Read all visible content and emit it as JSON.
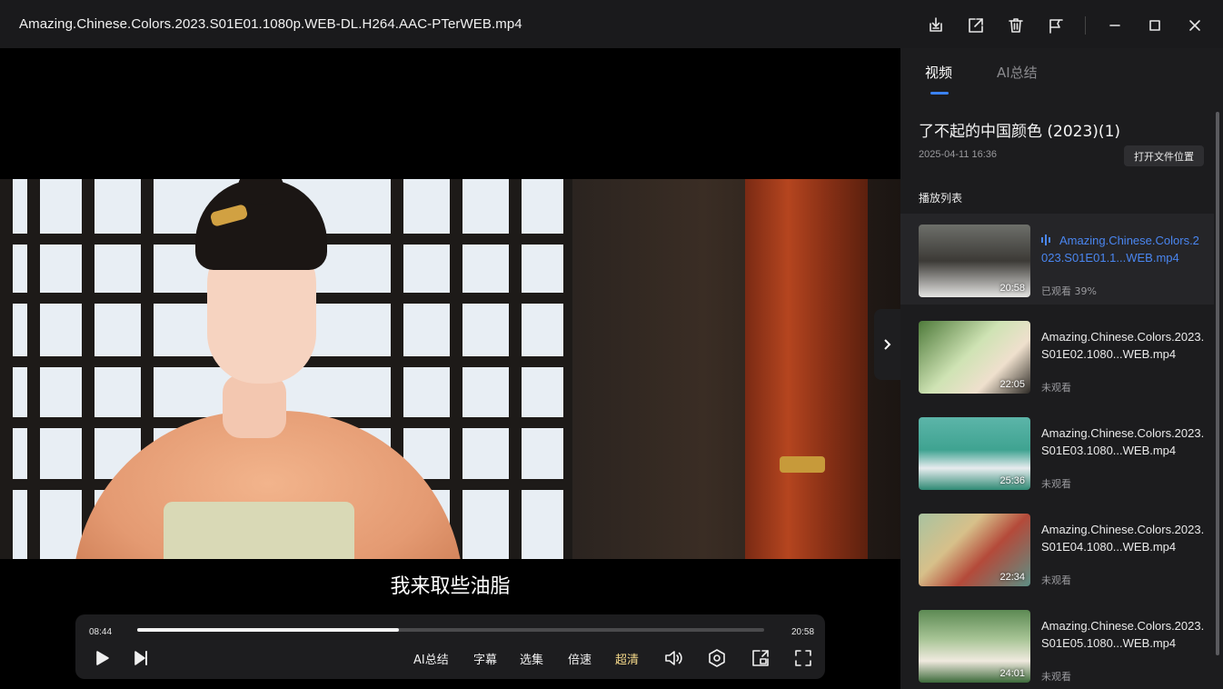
{
  "window": {
    "title": "Amazing.Chinese.Colors.2023.S01E01.1080p.WEB-DL.H264.AAC-PTerWEB.mp4",
    "buttons": [
      "download-icon",
      "external-open-icon",
      "trash-icon",
      "pin-icon",
      "minimize-icon",
      "maximize-icon",
      "close-icon"
    ]
  },
  "player": {
    "subtitle": "我来取些油脂",
    "current_time": "08:44",
    "total_time": "20:58",
    "progress": 0.417,
    "text_buttons": {
      "ai_summary": "AI总结",
      "subtitles": "字幕",
      "episodes": "选集",
      "speed": "倍速",
      "quality": "超清"
    },
    "accent_color": "#f5d98a"
  },
  "panel": {
    "tabs": [
      {
        "label": "视频",
        "active": true
      },
      {
        "label": "AI总结",
        "active": false
      }
    ],
    "series_title": "了不起的中国颜色 (2023)(1)",
    "date": "2025-04-11 16:36",
    "open_folder_label": "打开文件位置",
    "playlist_label": "播放列表",
    "accent_color": "#3b82f6",
    "episodes": [
      {
        "name": "Amazing.Chinese.Colors.2023.S01E01.1...WEB.mp4",
        "duration": "20:58",
        "status": "已观看 39%",
        "playing": true
      },
      {
        "name": "Amazing.Chinese.Colors.2023.S01E02.1080...WEB.mp4",
        "duration": "22:05",
        "status": "未观看",
        "playing": false
      },
      {
        "name": "Amazing.Chinese.Colors.2023.S01E03.1080...WEB.mp4",
        "duration": "25:36",
        "status": "未观看",
        "playing": false
      },
      {
        "name": "Amazing.Chinese.Colors.2023.S01E04.1080...WEB.mp4",
        "duration": "22:34",
        "status": "未观看",
        "playing": false
      },
      {
        "name": "Amazing.Chinese.Colors.2023.S01E05.1080...WEB.mp4",
        "duration": "24:01",
        "status": "未观看",
        "playing": false
      }
    ]
  }
}
